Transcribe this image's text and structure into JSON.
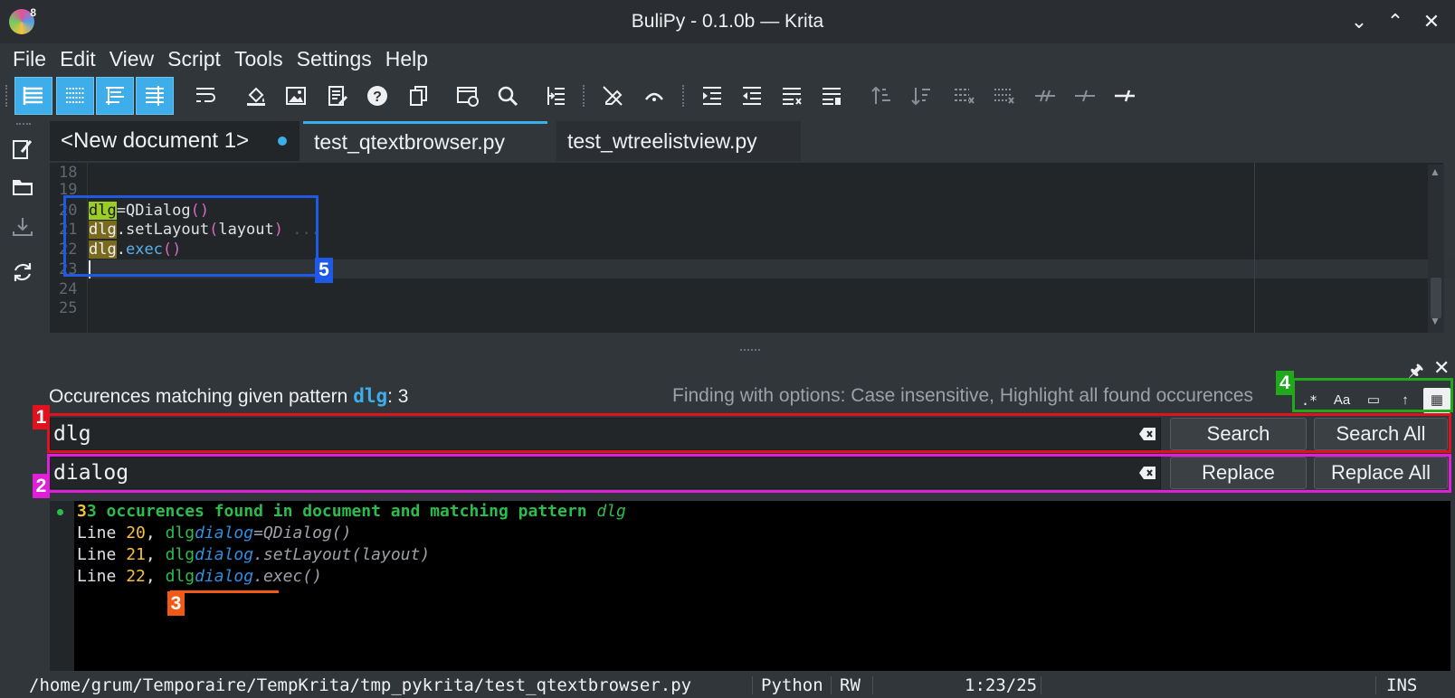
{
  "window": {
    "title": "BuliPy - 0.1.0b — Krita",
    "logo_badge": "8"
  },
  "menu": [
    "File",
    "Edit",
    "View",
    "Script",
    "Tools",
    "Settings",
    "Help"
  ],
  "tabs": [
    {
      "label": "<New document 1>",
      "modified": true
    },
    {
      "label": "test_qtextbrowser.py"
    },
    {
      "label": "test_wtreelistview.py"
    }
  ],
  "editor": {
    "line_numbers": [
      "18",
      "19",
      "20",
      "21",
      "22",
      "23",
      "24",
      "25"
    ],
    "code": {
      "l20_var": "dlg",
      "l20_rest": "=QDialog",
      "l20_paren": "()",
      "l21_var": "dlg",
      "l21_rest": ".setLayout",
      "l21_open": "(",
      "l21_arg": "layout",
      "l21_close": ")",
      "l21_fold": "...",
      "l22_var": "dlg",
      "l22_dot": ".",
      "l22_rest": "exec",
      "l22_paren": "()"
    }
  },
  "search": {
    "summary_prefix": "Occurences matching given pattern ",
    "summary_pattern": "dlg",
    "summary_suffix": ": 3",
    "options_text": "Finding with options: Case insensitive, Highlight all found occurences",
    "find_value": "dlg",
    "replace_value": "dialog",
    "search_button": "Search",
    "search_all_button": "Search All",
    "replace_button": "Replace",
    "replace_all_button": "Replace All",
    "option_buttons": [
      ".*",
      "Aa",
      "▭",
      "↑",
      "▦"
    ]
  },
  "results": {
    "header": "3 occurences found in document and matching pattern ",
    "header_pattern": "dlg",
    "line_word": "Line ",
    "rows": [
      {
        "num": "20",
        "old": "dlg",
        "new": "dialog",
        "rest": "=QDialog()"
      },
      {
        "num": "21",
        "old": "dlg",
        "new": "dialog",
        "rest": ".setLayout(layout)"
      },
      {
        "num": "22",
        "old": "dlg",
        "new": "dialog",
        "rest": ".exec()"
      }
    ]
  },
  "annotations": [
    "1",
    "2",
    "3",
    "4",
    "5"
  ],
  "status": {
    "path": "/home/grum/Temporaire/TempKrita/tmp_pykrita/test_qtextbrowser.py",
    "language": "Python",
    "mode": "RW",
    "position": "1:23/25",
    "insert_mode": "INS"
  },
  "colors": {
    "accent": "#3daee9",
    "box1": "#e0121e",
    "box2": "#e020d8",
    "box3": "#f05a14",
    "box4": "#22a81c",
    "box5": "#1e5ae6"
  }
}
